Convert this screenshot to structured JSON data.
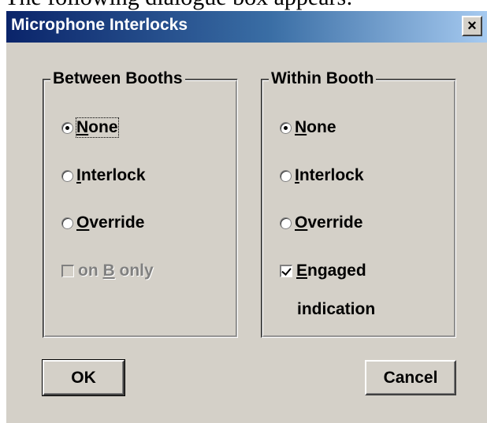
{
  "top_text": "The following dialogue box appears:",
  "dialog": {
    "title": "Microphone Interlocks",
    "close_glyph": "×"
  },
  "between_booths": {
    "legend": "Between Booths",
    "options": [
      {
        "label": "None",
        "mnemonic": "N",
        "rest": "one",
        "checked": true
      },
      {
        "label": "Interlock",
        "mnemonic": "I",
        "rest": "nterlock",
        "checked": false
      },
      {
        "label": "Override",
        "mnemonic": "O",
        "rest": "verride",
        "checked": false
      }
    ],
    "checkbox": {
      "prefix": "on ",
      "mnemonic": "B",
      "rest": " only",
      "checked": false,
      "enabled": false
    }
  },
  "within_booth": {
    "legend": "Within Booth",
    "options": [
      {
        "label": "None",
        "mnemonic": "N",
        "rest": "one",
        "checked": true
      },
      {
        "label": "Interlock",
        "mnemonic": "I",
        "rest": "nterlock",
        "checked": false
      },
      {
        "label": "Override",
        "mnemonic": "O",
        "rest": "verride",
        "checked": false
      }
    ],
    "checkbox": {
      "mnemonic": "E",
      "rest": "ngaged",
      "line2": "indication",
      "checked": true,
      "enabled": true
    }
  },
  "buttons": {
    "ok": "OK",
    "cancel": "Cancel"
  },
  "icons": {
    "close": "close-icon",
    "radio": "radio-icon",
    "checkbox": "checkbox-icon"
  },
  "colors": {
    "title_start": "#0a246a",
    "title_end": "#a6caf0",
    "face": "#d4d0c8"
  }
}
